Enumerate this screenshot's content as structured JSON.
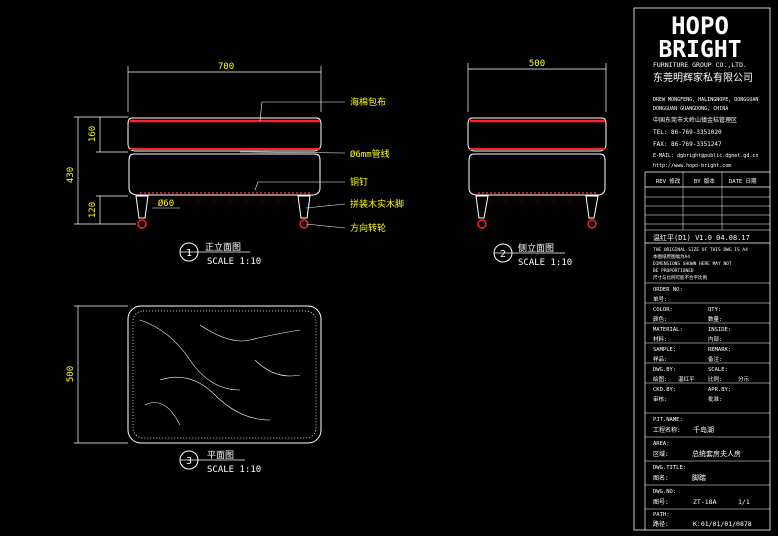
{
  "brand": {
    "logo_line1": "HOPO",
    "logo_line2": "BRIGHT",
    "company_en": "FURNITURE GROUP CO.,LTD.",
    "company_cn": "东莞明辉家私有限公司",
    "address_en": "DREW MONGFENG, HALINGNOPE, DONGGUAN",
    "address_en2": "DONGGUAN GUANGDONG, CHINA",
    "address_cn": "中国东莞市大岭山镇金桔管理区",
    "tel": "TEL: 86-769-3351020",
    "fax": "FAX: 86-769-3351247",
    "email": "E-MAIL: dgbright@public.dgnet.gd.cn",
    "web": "http://www.hopo-bright.com"
  },
  "revision_header": [
    "REV 修改",
    "BY 版本",
    "DATE 日期"
  ],
  "designer_line": "温红平(D1) V1.0  04.08.17",
  "notice_lines": [
    "THE ORIGINAL SIZE OF THIS DWG IS A4",
    "本图纸原图幅为A4",
    "DIMENSIONS SHOWN HERE MAY NOT",
    "BE PROPORTIONED",
    "尺寸与比例可能不合平比例"
  ],
  "fields": [
    {
      "l1": "ORDER NO:",
      "v1": "",
      "l2": "",
      "v2": ""
    },
    {
      "l1": "单号:",
      "v1": "",
      "l2": "",
      "v2": ""
    },
    {
      "l1": "COLOR:",
      "v1": "",
      "l2": "QTY:",
      "v2": ""
    },
    {
      "l1": "颜色:",
      "v1": "",
      "l2": "数量:",
      "v2": ""
    },
    {
      "l1": "MATERIAL:",
      "v1": "",
      "l2": "INSIDE:",
      "v2": ""
    },
    {
      "l1": "材料:",
      "v1": "",
      "l2": "内部:",
      "v2": ""
    },
    {
      "l1": "SAMPLE:",
      "v1": "",
      "l2": "REMARK:",
      "v2": ""
    },
    {
      "l1": "样品:",
      "v1": "",
      "l2": "备注:",
      "v2": ""
    },
    {
      "l1": "DWG.BY:",
      "v1": "",
      "l2": "SCALE:",
      "v2": ""
    },
    {
      "l1": "绘图:",
      "v1": "温红平",
      "l2": "比例:",
      "v2": "分示"
    },
    {
      "l1": "CKD.BY:",
      "v1": "",
      "l2": "APR.BY:",
      "v2": ""
    },
    {
      "l1": "审核:",
      "v1": "",
      "l2": "批准:",
      "v2": ""
    }
  ],
  "project": {
    "label_en": "PJT.NAME:",
    "label_cn": "工程名称:",
    "value": "千岛湖"
  },
  "area": {
    "label_en": "AREA:",
    "label_cn": "区域:",
    "value": "总统套房夫人房"
  },
  "title": {
    "label_en": "DWG.TITLE:",
    "label_cn": "图名:",
    "value": "脚踏"
  },
  "dwgno": {
    "label_en": "DWG.NO:",
    "label_cn": "图号:",
    "value": "ZT-18A",
    "sheet": "1/1"
  },
  "path": {
    "label_en": "PATH:",
    "label_cn": "路径:",
    "value": "K:01/01/01/0878"
  },
  "front_view": {
    "dim_width": "700",
    "dim_total_height": "430",
    "dim_top": "160",
    "dim_leg": "120",
    "dim_leg_dia": "Ø60",
    "callouts": [
      "海棉包布",
      "Ø6mm管线",
      "铜钉",
      "拼装木实木脚",
      "方向转轮"
    ],
    "number": "1",
    "name": "正立面图",
    "scale": "SCALE 1:10"
  },
  "side_view": {
    "dim_width": "500",
    "number": "2",
    "name": "侧立面图",
    "scale": "SCALE 1:10"
  },
  "plan_view": {
    "dim_depth": "500",
    "number": "3",
    "name": "平面图",
    "scale": "SCALE 1:10"
  }
}
